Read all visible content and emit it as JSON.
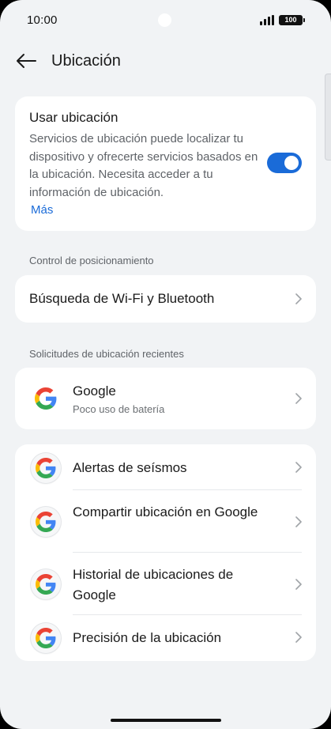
{
  "status_bar": {
    "time": "10:00",
    "battery": "100"
  },
  "header": {
    "title": "Ubicación"
  },
  "location_card": {
    "title": "Usar ubicación",
    "description": "Servicios de ubicación puede localizar tu dispositivo y ofrecerte servicios basados en la ubicación. Necesita acceder a tu información de ubicación.",
    "more_link": "Más",
    "toggle_on": true
  },
  "positioning_section": {
    "label": "Control de posicionamiento",
    "item": "Búsqueda de Wi-Fi y Bluetooth"
  },
  "recent_section": {
    "label": "Solicitudes de ubicación recientes",
    "app_name": "Google",
    "app_sub": "Poco uso de batería"
  },
  "google_services": {
    "items": [
      {
        "label": "Alertas de seísmos"
      },
      {
        "label": "Compartir ubicación en Google"
      },
      {
        "label": "Historial de ubicaciones de Google"
      },
      {
        "label": "Precisión de la ubicación"
      }
    ]
  },
  "colors": {
    "accent": "#1a6bd8",
    "background": "#f1f3f5",
    "card": "#ffffff"
  }
}
